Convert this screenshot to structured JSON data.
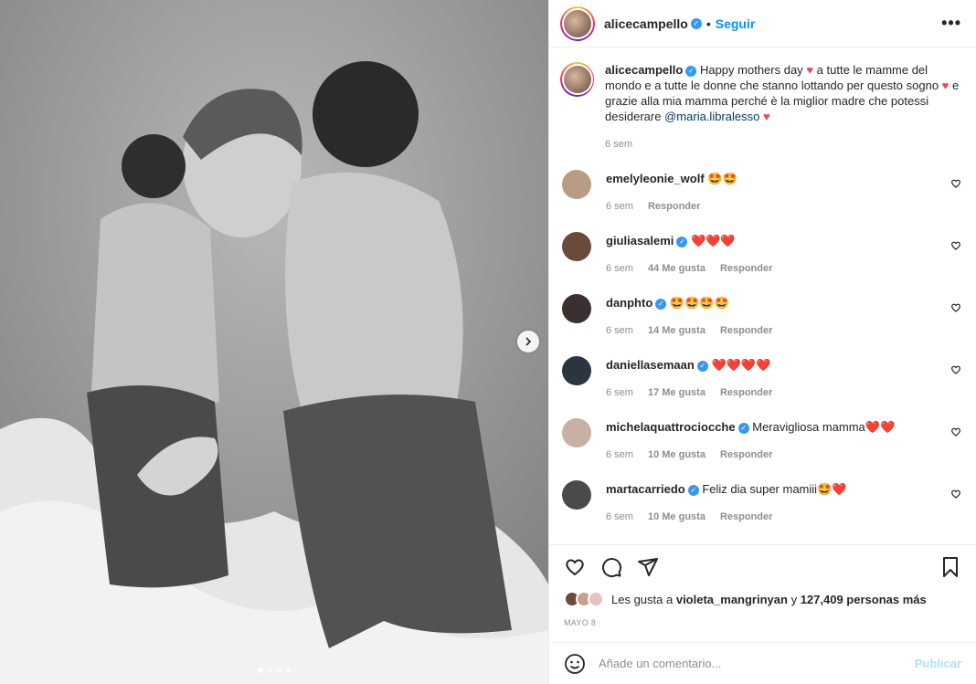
{
  "post": {
    "username": "alicecampello",
    "follow_label": "Seguir",
    "more_label": "•••",
    "caption": {
      "username": "alicecampello",
      "text_1": "Happy mothers day",
      "text_2": "a tutte le mamme del mondo e a tutte le donne che stanno lottando per questo sogno",
      "text_3": "e grazie alla mia mamma perché è la miglior madre che potessi desiderare",
      "mention": "@maria.libralesso",
      "time": "6 sem"
    },
    "comments": [
      {
        "user": "emelyleonie_wolf",
        "verified": false,
        "text": "🤩🤩",
        "time": "6 sem",
        "likes": "",
        "reply": "Responder",
        "avatar_color": "#b89c84"
      },
      {
        "user": "giuliasalemi",
        "verified": true,
        "text": "❤️❤️❤️",
        "time": "6 sem",
        "likes": "44 Me gusta",
        "reply": "Responder",
        "avatar_color": "#6b4a3c"
      },
      {
        "user": "danphto",
        "verified": true,
        "text": "🤩🤩🤩🤩",
        "time": "6 sem",
        "likes": "14 Me gusta",
        "reply": "Responder",
        "avatar_color": "#3a3030"
      },
      {
        "user": "daniellasemaan",
        "verified": true,
        "text": "❤️❤️❤️❤️",
        "time": "6 sem",
        "likes": "17 Me gusta",
        "reply": "Responder",
        "avatar_color": "#2c3440"
      },
      {
        "user": "michelaquattrociocche",
        "verified": true,
        "text": "Meravigliosa mamma❤️❤️",
        "time": "6 sem",
        "likes": "10 Me gusta",
        "reply": "Responder",
        "avatar_color": "#c8b0a4"
      },
      {
        "user": "martacarriedo",
        "verified": true,
        "text": "Feliz dia super mamiii🤩❤️",
        "time": "6 sem",
        "likes": "10 Me gusta",
        "reply": "Responder",
        "avatar_color": "#4a4a4a"
      }
    ],
    "likes_prefix": "Les gusta a",
    "likes_user": "violeta_mangrinyan",
    "likes_and": "y",
    "likes_others": "127,409 personas más",
    "date": "MAYO 8",
    "comment_placeholder": "Añade un comentario...",
    "publish_label": "Publicar"
  },
  "colors": {
    "accent": "#0095f6",
    "heart": "#ed4956",
    "verified": "#3897f0",
    "muted": "#8e8e8e"
  },
  "icons": [
    "heart-icon",
    "comment-icon",
    "share-icon",
    "bookmark-icon",
    "smiley-icon",
    "chevron-right-icon",
    "more-icon",
    "verified-badge-icon"
  ]
}
